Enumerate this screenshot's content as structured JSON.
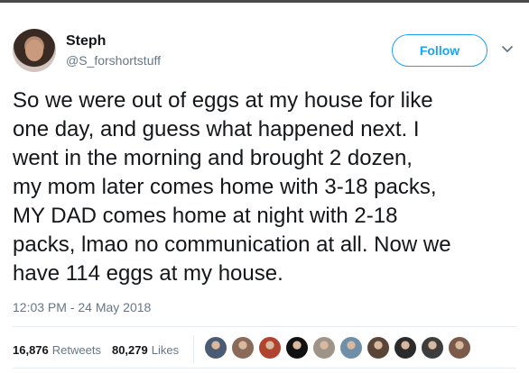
{
  "user": {
    "name": "Steph",
    "handle": "@S_forshortstuff"
  },
  "follow_label": "Follow",
  "tweet": {
    "text": "So we were out of eggs at my house for like\none day, and guess what happened next. I\nwent in the morning and brought 2 dozen,\nmy mom later comes home with 3-18 packs,\nMY DAD comes home at night with 2-18\npacks, lmao no communication at all. Now we\nhave 114 eggs at my house.",
    "timestamp": "12:03 PM - 24 May 2018"
  },
  "stats": {
    "retweets_count": "16,876",
    "retweets_label": "Retweets",
    "likes_count": "80,279",
    "likes_label": "Likes"
  },
  "likers": [
    {
      "icon": "liker-avatar",
      "color": "#4a5b73"
    },
    {
      "icon": "liker-avatar",
      "color": "#8a6a58"
    },
    {
      "icon": "liker-avatar",
      "color": "#b0432f"
    },
    {
      "icon": "liker-avatar",
      "color": "#111111"
    },
    {
      "icon": "liker-avatar",
      "color": "#9e9488"
    },
    {
      "icon": "liker-avatar",
      "color": "#6f8fa8"
    },
    {
      "icon": "liker-avatar",
      "color": "#5a4638"
    },
    {
      "icon": "liker-avatar",
      "color": "#2b2b2b"
    },
    {
      "icon": "liker-avatar",
      "color": "#3d3d3d"
    },
    {
      "icon": "liker-avatar",
      "color": "#7a5a4a"
    }
  ],
  "colors": {
    "accent": "#1da1f2",
    "text": "#14171a",
    "muted": "#657786"
  }
}
